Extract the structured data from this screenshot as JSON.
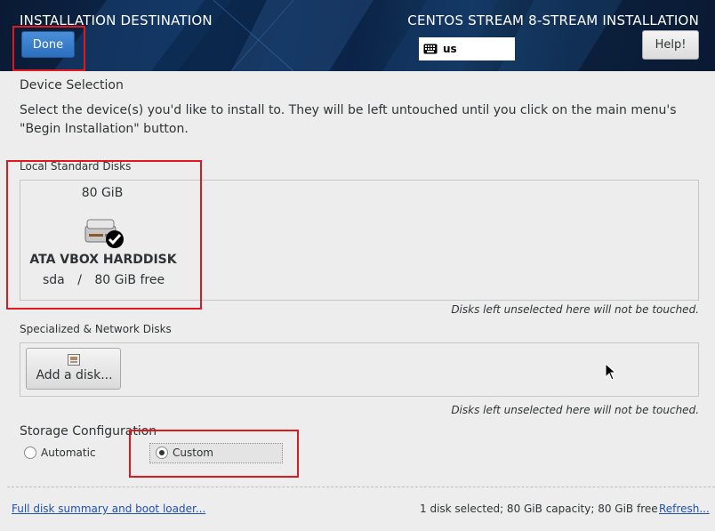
{
  "header": {
    "title": "INSTALLATION DESTINATION",
    "product": "CENTOS STREAM 8-STREAM INSTALLATION",
    "done_label": "Done",
    "keyboard_layout": "us",
    "help_label": "Help!",
    "keyboard_icon": "keyboard-icon"
  },
  "device_selection": {
    "heading": "Device Selection",
    "description_line1": "Select the device(s) you'd like to install to.  They will be left untouched until you click on the main menu's",
    "description_line2": "\"Begin Installation\" button."
  },
  "local_disks": {
    "heading": "Local Standard Disks",
    "disks": [
      {
        "size": "80 GiB",
        "name": "ATA VBOX HARDDISK",
        "device": "sda",
        "separator": "/",
        "free": "80 GiB free",
        "selected": true,
        "icon": "harddisk-checked-icon"
      }
    ],
    "note": "Disks left unselected here will not be touched."
  },
  "network_disks": {
    "heading": "Specialized & Network Disks",
    "add_label": "Add a disk...",
    "add_icon": "disk-add-icon",
    "note": "Disks left unselected here will not be touched."
  },
  "storage_config": {
    "heading": "Storage Configuration",
    "options": [
      {
        "label": "Automatic",
        "selected": false
      },
      {
        "label": "Custom",
        "selected": true
      }
    ]
  },
  "footer": {
    "summary_link": "Full disk summary and boot loader...",
    "summary_text": "1 disk selected; 80 GiB capacity; 80 GiB free",
    "refresh_link": "Refresh..."
  },
  "colors": {
    "header_bg": "#0e2c55",
    "done_button": "#2c6fbd",
    "highlight": "#e0191f",
    "link": "#1f4fb3"
  }
}
